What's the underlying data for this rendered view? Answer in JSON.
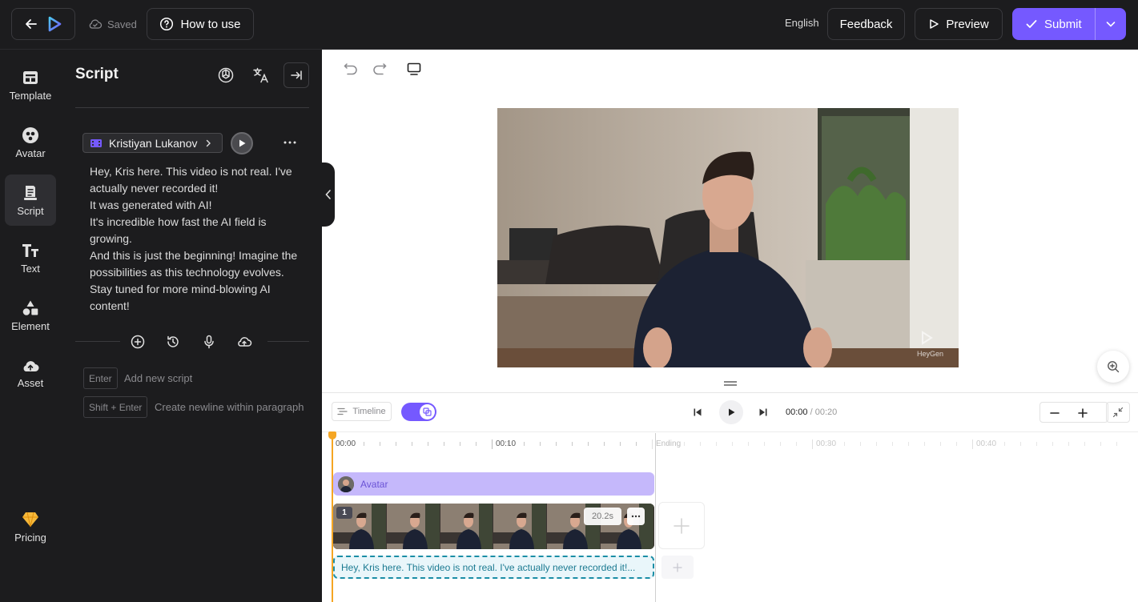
{
  "topbar": {
    "saved_label": "Saved",
    "how_to_use_label": "How to use",
    "language": "English",
    "feedback_label": "Feedback",
    "preview_label": "Preview",
    "submit_label": "Submit"
  },
  "rail": {
    "items": [
      {
        "label": "Template",
        "icon": "template-icon"
      },
      {
        "label": "Avatar",
        "icon": "avatar-icon"
      },
      {
        "label": "Script",
        "icon": "script-icon",
        "active": true
      },
      {
        "label": "Text",
        "icon": "text-icon"
      },
      {
        "label": "Element",
        "icon": "element-icon"
      },
      {
        "label": "Asset",
        "icon": "asset-icon"
      }
    ],
    "pricing_label": "Pricing"
  },
  "script_panel": {
    "title": "Script",
    "avatar_name": "Kristiyan Lukanov",
    "script_lines": [
      "Hey, Kris here. This video is not real. I've actually never recorded it!",
      "It was generated with AI!",
      "It's incredible how fast the AI field is growing.",
      "And this is just the beginning! Imagine the possibilities as this technology evolves. Stay tuned for more mind-blowing AI content!"
    ],
    "hints": [
      {
        "key": "Enter",
        "description": "Add new script"
      },
      {
        "key": "Shift + Enter",
        "description": "Create newline within paragraph"
      }
    ]
  },
  "canvas": {
    "watermark": "HeyGen"
  },
  "timeline": {
    "timeline_label": "Timeline",
    "current_time": "00:00",
    "total_time": "/ 00:20",
    "ruler": [
      "00:00",
      "00:10",
      "Ending",
      "00:30",
      "00:40"
    ],
    "avatar_track_label": "Avatar",
    "scene_number": "1",
    "scene_duration": "20.2s",
    "script_track_text": "Hey, Kris here. This video is not real. I've actually never recorded it!..."
  },
  "colors": {
    "accent": "#7559ff",
    "playhead": "#f5a623",
    "avatar_track": "#c5b8fb",
    "script_track_border": "#1b8ea6"
  }
}
